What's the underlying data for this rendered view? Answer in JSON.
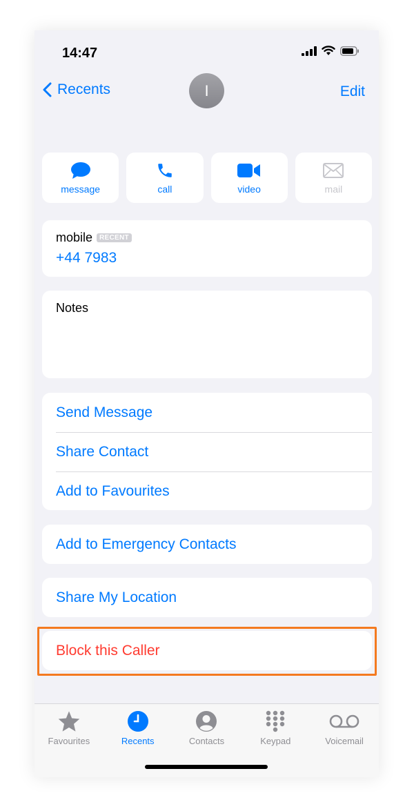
{
  "status_bar": {
    "time": "14:47"
  },
  "nav": {
    "back_label": "Recents",
    "edit_label": "Edit",
    "avatar_initial": "I"
  },
  "actions": [
    {
      "label": "message",
      "icon": "message-bubble-icon",
      "enabled": true
    },
    {
      "label": "call",
      "icon": "phone-icon",
      "enabled": true
    },
    {
      "label": "video",
      "icon": "video-camera-icon",
      "enabled": true
    },
    {
      "label": "mail",
      "icon": "envelope-icon",
      "enabled": false
    }
  ],
  "phone_card": {
    "label": "mobile",
    "badge": "RECENT",
    "number": "+44 7983"
  },
  "notes": {
    "label": "Notes"
  },
  "options": {
    "send_message": "Send Message",
    "share_contact": "Share Contact",
    "add_favourites": "Add to Favourites",
    "add_emergency": "Add to Emergency Contacts",
    "share_location": "Share My Location",
    "block_caller": "Block this Caller"
  },
  "tabbar": {
    "tabs": [
      {
        "label": "Favourites",
        "icon": "star-icon",
        "active": false
      },
      {
        "label": "Recents",
        "icon": "clock-icon",
        "active": true
      },
      {
        "label": "Contacts",
        "icon": "person-circle-icon",
        "active": false
      },
      {
        "label": "Keypad",
        "icon": "keypad-icon",
        "active": false
      },
      {
        "label": "Voicemail",
        "icon": "voicemail-icon",
        "active": false
      }
    ]
  },
  "colors": {
    "accent": "#007aff",
    "destructive": "#ff3b30",
    "highlight_border": "#f47a20",
    "background": "#f2f2f7"
  }
}
